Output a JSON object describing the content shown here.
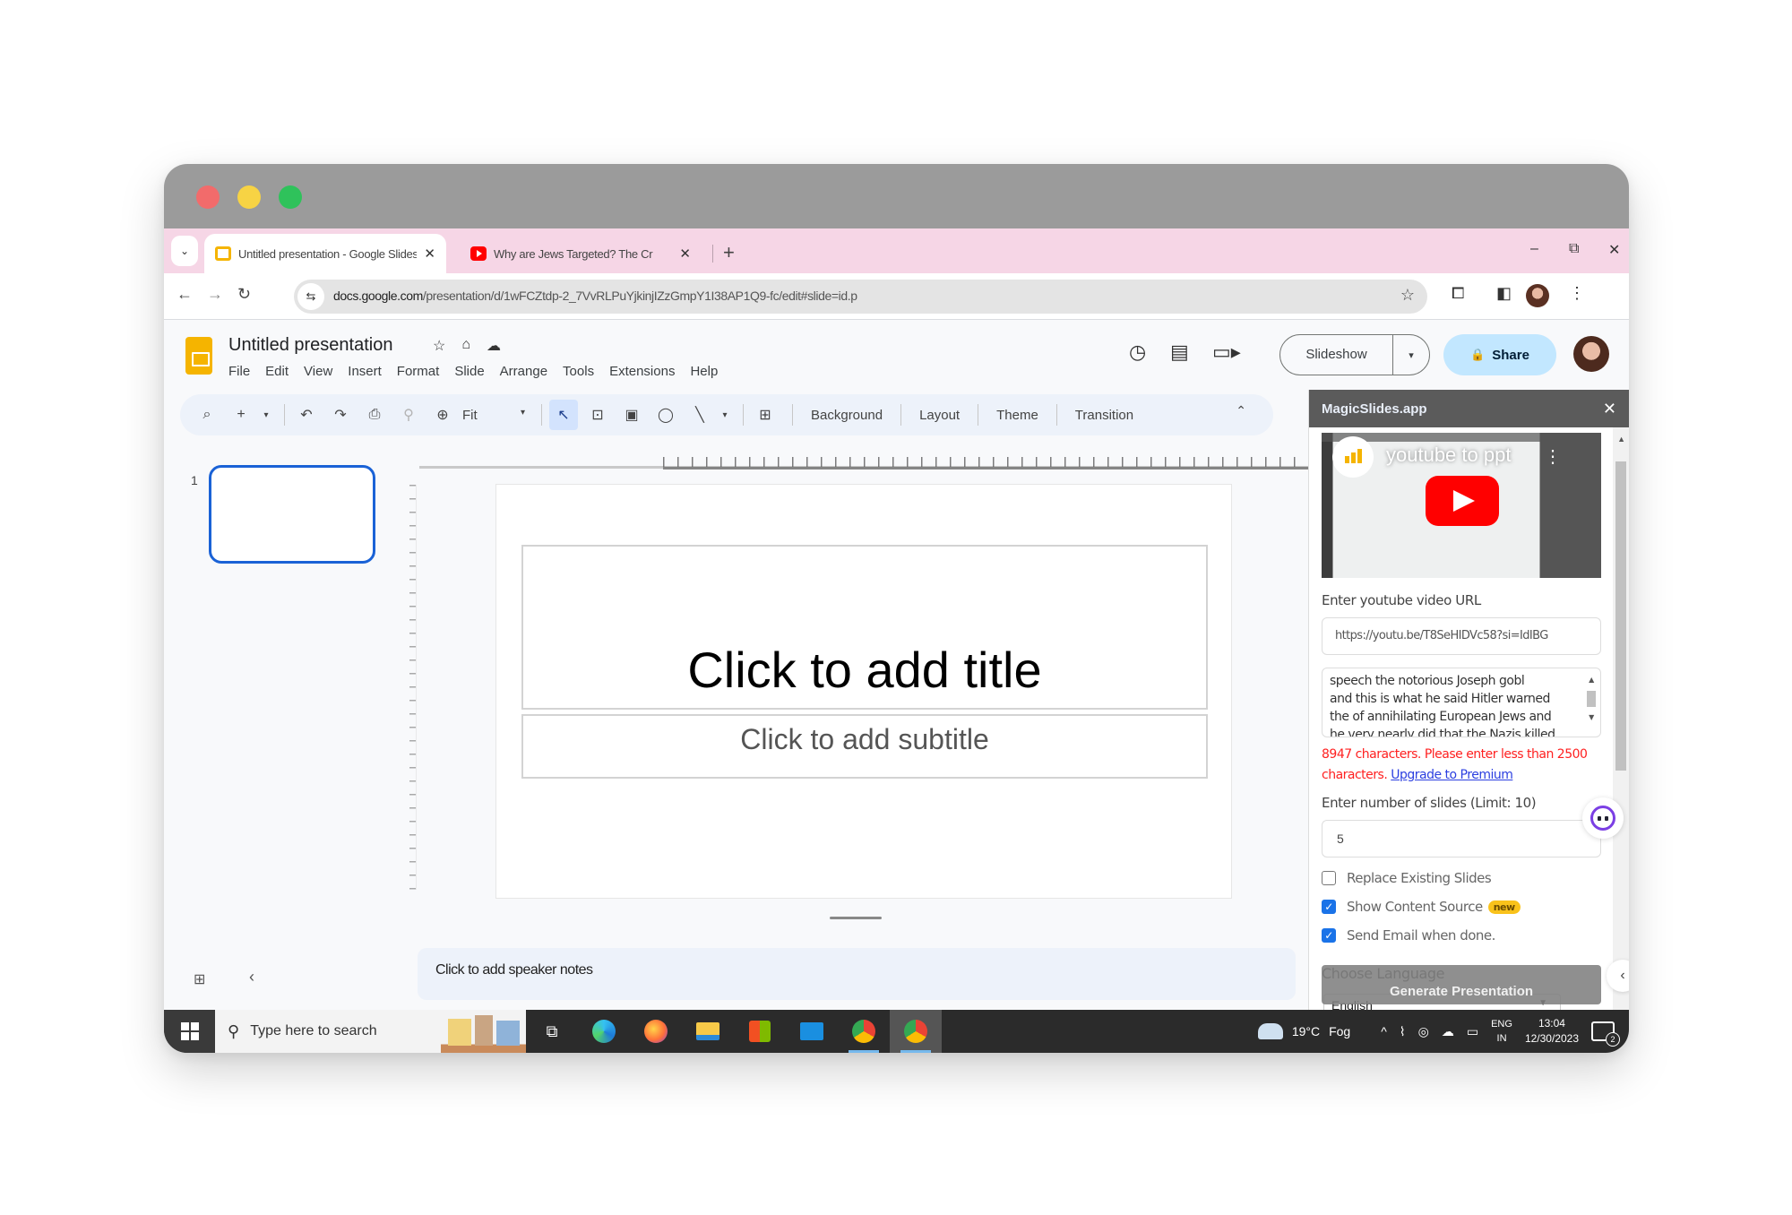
{
  "browser": {
    "tabs": [
      {
        "title": "Untitled presentation - Google Slides",
        "favicon": "google-slides-icon",
        "active": true
      },
      {
        "title": "Why are Jews Targeted? The Cr",
        "favicon": "youtube-icon",
        "active": false
      }
    ],
    "tab_close_glyph": "✕",
    "new_tab_glyph": "+",
    "tab_list_glyph": "⌄",
    "window_controls": {
      "minimize": "–",
      "restore": "⧉",
      "close": "✕"
    },
    "nav": {
      "back": "←",
      "forward": "→",
      "reload": "↻"
    },
    "url_host": "docs.google.com",
    "url_path": "/presentation/d/1wFCZtdp-2_7VvRLPuYjkinjIZzGmpY1I38AP1Q9-fc/edit#slide=id.p",
    "site_info_glyph": "⇆",
    "bookmark_glyph": "☆",
    "extensions_glyph": "⧠",
    "side_panel_glyph": "◧",
    "menu_glyph": "⋮"
  },
  "docs": {
    "title": "Untitled presentation",
    "title_icons": {
      "star": "☆",
      "move": "⌂",
      "cloud": "☁"
    },
    "menu": [
      "File",
      "Edit",
      "View",
      "Insert",
      "Format",
      "Slide",
      "Arrange",
      "Tools",
      "Extensions",
      "Help"
    ],
    "header_icons": {
      "history": "◷",
      "comments": "▤",
      "meet": "▭▸"
    },
    "slideshow_label": "Slideshow",
    "slideshow_drop": "▾",
    "share_label": "Share",
    "share_icon": "🔒",
    "toolbar": {
      "search": "⌕",
      "new_slide": "+",
      "new_slide_drop": "▾",
      "undo": "↶",
      "redo": "↷",
      "print": "⎙",
      "paint_format": "⚲",
      "zoom_icon": "⊕",
      "zoom_value": "Fit",
      "zoom_drop": "▾",
      "select": "↖",
      "text_box": "⊡",
      "image": "▣",
      "shape": "◯",
      "line": "╲",
      "line_drop": "▾",
      "comment": "⊞",
      "background": "Background",
      "layout": "Layout",
      "theme": "Theme",
      "transition": "Transition",
      "collapse": "⌃"
    },
    "filmstrip": {
      "slide_number": "1",
      "grid_glyph": "⊞",
      "collapse_glyph": "‹"
    },
    "slide": {
      "title_placeholder": "Click to add title",
      "subtitle_placeholder": "Click to add subtitle"
    },
    "speaker_notes_placeholder": "Click to add speaker notes"
  },
  "magicslides": {
    "header": "MagicSlides.app",
    "close_glyph": "✕",
    "video": {
      "channel_title": "youtube to ppt",
      "menu_glyph": "⋮"
    },
    "url_label": "Enter youtube video URL",
    "url_value": "https://youtu.be/T8SeHIDVc58?si=IdIBG",
    "transcript_lines": [
      "speech the notorious Joseph gobl",
      "and this is what he said Hitler warned",
      "the of annihilating European Jews and",
      "he very nearly did that the Nazis killed"
    ],
    "error_text": "8947 characters. Please enter less than 2500 characters.",
    "upgrade_link": "Upgrade to Premium",
    "slides_label": "Enter number of slides (Limit: 10)",
    "slides_value": "5",
    "options": [
      {
        "label": "Replace Existing Slides",
        "checked": false,
        "badge": ""
      },
      {
        "label": "Show Content Source",
        "checked": true,
        "badge": "new"
      },
      {
        "label": "Send Email when done.",
        "checked": true,
        "badge": ""
      }
    ],
    "check_glyph": "✓",
    "language_label": "Choose Language",
    "language_value": "English",
    "language_drop": "▼",
    "generate_label": "Generate Presentation",
    "expand_glyph": "‹"
  },
  "taskbar": {
    "search_placeholder": "Type here to search",
    "search_glyph": "⚲",
    "task_view_glyph": "⧉",
    "weather": {
      "temp": "19°C",
      "condition": "Fog"
    },
    "tray_chevron": "^",
    "language": {
      "line1": "ENG",
      "line2": "IN"
    },
    "time": "13:04",
    "date": "12/30/2023",
    "notification_count": "2"
  },
  "colors": {
    "accent_blue": "#1a62d6",
    "share_bg": "#c2e7ff",
    "error_red": "#ff2020",
    "link_blue": "#2b3fe0",
    "badge_yellow": "#f9c21b",
    "youtube_red": "#ff0000"
  }
}
